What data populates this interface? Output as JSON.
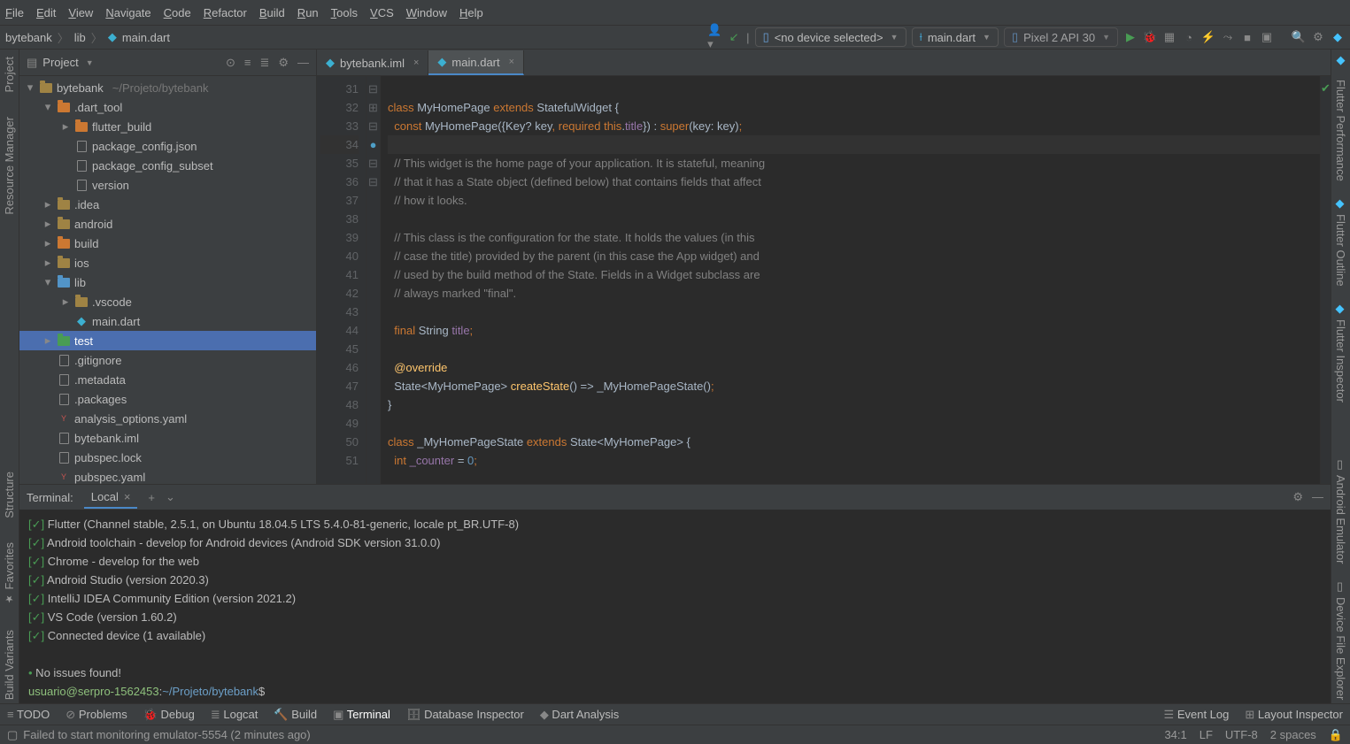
{
  "menubar": [
    "File",
    "Edit",
    "View",
    "Navigate",
    "Code",
    "Refactor",
    "Build",
    "Run",
    "Tools",
    "VCS",
    "Window",
    "Help"
  ],
  "breadcrumbs": {
    "project": "bytebank",
    "folder": "lib",
    "file": "main.dart"
  },
  "toolbar": {
    "device": "<no device selected>",
    "run_config": "main.dart",
    "emulator": "Pixel 2 API 30"
  },
  "project_panel": {
    "title": "Project",
    "tree": [
      {
        "depth": 0,
        "arrow": "▾",
        "icon": "folder-root",
        "label": "bytebank",
        "hint": "~/Projeto/bytebank"
      },
      {
        "depth": 1,
        "arrow": "▾",
        "icon": "folder-red",
        "label": ".dart_tool"
      },
      {
        "depth": 2,
        "arrow": "▸",
        "icon": "folder-red",
        "label": "flutter_build"
      },
      {
        "depth": 2,
        "arrow": "",
        "icon": "file",
        "label": "package_config.json"
      },
      {
        "depth": 2,
        "arrow": "",
        "icon": "file",
        "label": "package_config_subset"
      },
      {
        "depth": 2,
        "arrow": "",
        "icon": "file",
        "label": "version"
      },
      {
        "depth": 1,
        "arrow": "▸",
        "icon": "folder",
        "label": ".idea"
      },
      {
        "depth": 1,
        "arrow": "▸",
        "icon": "folder",
        "label": "android"
      },
      {
        "depth": 1,
        "arrow": "▸",
        "icon": "folder-red",
        "label": "build"
      },
      {
        "depth": 1,
        "arrow": "▸",
        "icon": "folder",
        "label": "ios"
      },
      {
        "depth": 1,
        "arrow": "▾",
        "icon": "folder-blue",
        "label": "lib"
      },
      {
        "depth": 2,
        "arrow": "▸",
        "icon": "folder",
        "label": ".vscode"
      },
      {
        "depth": 2,
        "arrow": "",
        "icon": "dart",
        "label": "main.dart"
      },
      {
        "depth": 1,
        "arrow": "▸",
        "icon": "folder-green",
        "label": "test",
        "sel": true
      },
      {
        "depth": 1,
        "arrow": "",
        "icon": "file",
        "label": ".gitignore"
      },
      {
        "depth": 1,
        "arrow": "",
        "icon": "file",
        "label": ".metadata"
      },
      {
        "depth": 1,
        "arrow": "",
        "icon": "file",
        "label": ".packages"
      },
      {
        "depth": 1,
        "arrow": "",
        "icon": "yaml",
        "label": "analysis_options.yaml"
      },
      {
        "depth": 1,
        "arrow": "",
        "icon": "file",
        "label": "bytebank.iml"
      },
      {
        "depth": 1,
        "arrow": "",
        "icon": "file",
        "label": "pubspec.lock"
      },
      {
        "depth": 1,
        "arrow": "",
        "icon": "yaml",
        "label": "pubspec.yaml"
      }
    ]
  },
  "editor": {
    "tabs": [
      {
        "label": "bytebank.iml",
        "active": false
      },
      {
        "label": "main.dart",
        "active": true
      }
    ],
    "first_line": 31,
    "lines": [
      {
        "n": 31,
        "html": ""
      },
      {
        "n": 32,
        "html": "<span class='orange'>class</span> <span class='white'>MyHomePage</span> <span class='orange'>extends</span> <span class='white'>StatefulWidget {</span>",
        "fold": "−"
      },
      {
        "n": 33,
        "html": "  <span class='orange'>const</span> <span class='white'>MyHomePage({Key?</span> <span class='white'>key</span><span class='orange'>,</span> <span class='orange'>required</span> <span class='orange'>this</span><span class='white'>.</span><span class='purple'>title</span><span class='white'>}) : </span><span class='orange'>super</span><span class='white'>(key: key)</span><span class='orange'>;</span>"
      },
      {
        "n": 34,
        "html": "",
        "hl": true
      },
      {
        "n": 35,
        "html": "  <span class='grey'>// This widget is the home page of your application. It is stateful, meaning</span>",
        "fold": "+"
      },
      {
        "n": 36,
        "html": "  <span class='grey'>// that it has a State object (defined below) that contains fields that affect</span>"
      },
      {
        "n": 37,
        "html": "  <span class='grey'>// how it looks.</span>"
      },
      {
        "n": 38,
        "html": ""
      },
      {
        "n": 39,
        "html": "  <span class='grey'>// This class is the configuration for the state. It holds the values (in this</span>"
      },
      {
        "n": 40,
        "html": "  <span class='grey'>// case the title) provided by the parent (in this case the App widget) and</span>"
      },
      {
        "n": 41,
        "html": "  <span class='grey'>// used by the build method of the State. Fields in a Widget subclass are</span>"
      },
      {
        "n": 42,
        "html": "  <span class='grey'>// always marked \"final\".</span>",
        "fold": "−"
      },
      {
        "n": 43,
        "html": ""
      },
      {
        "n": 44,
        "html": "  <span class='orange'>final</span> <span class='white'>String</span> <span class='purple'>title</span><span class='orange'>;</span>"
      },
      {
        "n": 45,
        "html": ""
      },
      {
        "n": 46,
        "html": "  <span class='yellow'>@override</span>"
      },
      {
        "n": 47,
        "html": "  <span class='white'>State&lt;MyHomePage&gt;</span> <span class='yellow'>createState</span><span class='white'>() =&gt;</span> <span class='white'>_MyHomePageState()</span><span class='orange'>;</span>",
        "marker": "●"
      },
      {
        "n": 48,
        "html": "<span class='white'>}</span>",
        "fold": "−"
      },
      {
        "n": 49,
        "html": ""
      },
      {
        "n": 50,
        "html": "<span class='orange'>class</span> <span class='white'>_MyHomePageState</span> <span class='orange'>extends</span> <span class='white'>State&lt;MyHomePage&gt; {</span>",
        "fold": "−"
      },
      {
        "n": 51,
        "html": "  <span class='orange'>int</span> <span class='purple'>_counter</span> <span class='white'>=</span> <span class='blue'>0</span><span class='orange'>;</span>"
      }
    ]
  },
  "terminal": {
    "title": "Terminal:",
    "tab": "Local",
    "lines": [
      {
        "prefix": "[✓]",
        "text": "Flutter (Channel stable, 2.5.1, on Ubuntu 18.04.5 LTS 5.4.0-81-generic, locale pt_BR.UTF-8)"
      },
      {
        "prefix": "[✓]",
        "text": "Android toolchain - develop for Android devices (Android SDK version 31.0.0)"
      },
      {
        "prefix": "[✓]",
        "text": "Chrome - develop for the web"
      },
      {
        "prefix": "[✓]",
        "text": "Android Studio (version 2020.3)"
      },
      {
        "prefix": "[✓]",
        "text": "IntelliJ IDEA Community Edition (version 2021.2)"
      },
      {
        "prefix": "[✓]",
        "text": "VS Code (version 1.60.2)"
      },
      {
        "prefix": "[✓]",
        "text": "Connected device (1 available)"
      }
    ],
    "summary_prefix": "•",
    "summary": "No issues found!",
    "prompt_user": "usuario@serpro-1562453",
    "prompt_sep": ":",
    "prompt_path": "~/Projeto/bytebank",
    "prompt_end": "$"
  },
  "left_tools": [
    "Project",
    "Resource Manager",
    "Structure",
    "Favorites",
    "Build Variants"
  ],
  "right_tools": [
    "Flutter Performance",
    "Flutter Outline",
    "Flutter Inspector",
    "Android Emulator",
    "Device File Explorer"
  ],
  "bottombar": [
    "TODO",
    "Problems",
    "Debug",
    "Logcat",
    "Build",
    "Terminal",
    "Database Inspector",
    "Dart Analysis"
  ],
  "bottombar_active": "Terminal",
  "bottombar_right": [
    "Event Log",
    "Layout Inspector"
  ],
  "statusbar": {
    "left": "Failed to start monitoring emulator-5554 (2 minutes ago)",
    "right": [
      "34:1",
      "LF",
      "UTF-8",
      "2 spaces"
    ]
  }
}
